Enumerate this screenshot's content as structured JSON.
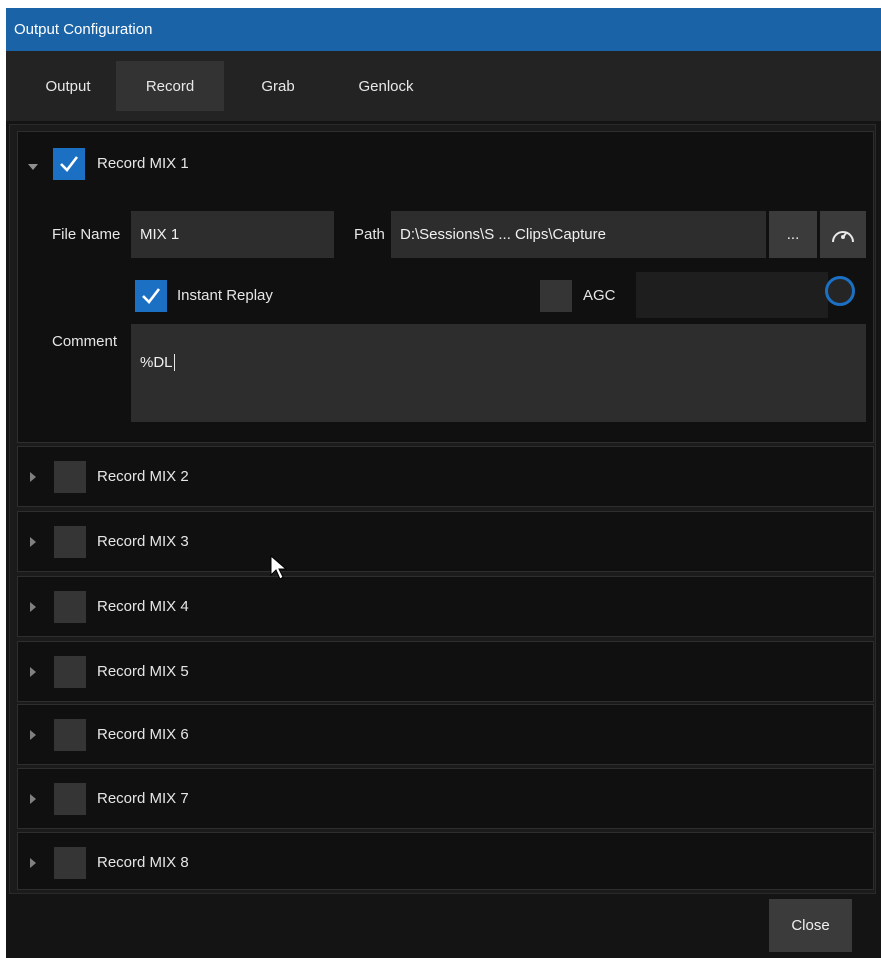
{
  "window": {
    "title": "Output Configuration"
  },
  "tabs": [
    {
      "label": "Output",
      "active": false
    },
    {
      "label": "Record",
      "active": true
    },
    {
      "label": "Grab",
      "active": false
    },
    {
      "label": "Genlock",
      "active": false
    }
  ],
  "record_mix_1": {
    "label": "Record MIX 1",
    "checked": true,
    "expanded": true,
    "file_name_label": "File Name",
    "file_name_value": "MIX 1",
    "path_label": "Path",
    "path_value": "D:\\Sessions\\S ... Clips\\Capture",
    "browse_button": "...",
    "instant_replay_label": "Instant Replay",
    "instant_replay_checked": true,
    "agc_label": "AGC",
    "agc_checked": false,
    "comment_label": "Comment",
    "comment_value": "%DL"
  },
  "collapsed_sections": [
    {
      "label": "Record MIX 2",
      "checked": false
    },
    {
      "label": "Record MIX 3",
      "checked": false
    },
    {
      "label": "Record MIX 4",
      "checked": false
    },
    {
      "label": "Record MIX 5",
      "checked": false
    },
    {
      "label": "Record MIX 6",
      "checked": false
    },
    {
      "label": "Record MIX 7",
      "checked": false
    },
    {
      "label": "Record MIX 8",
      "checked": false
    }
  ],
  "footer": {
    "close_label": "Close"
  },
  "colors": {
    "title_bar": "#1a63a6",
    "checkbox_checked": "#1c70c3",
    "background": "#141414",
    "field_background": "#2d2d2d"
  }
}
